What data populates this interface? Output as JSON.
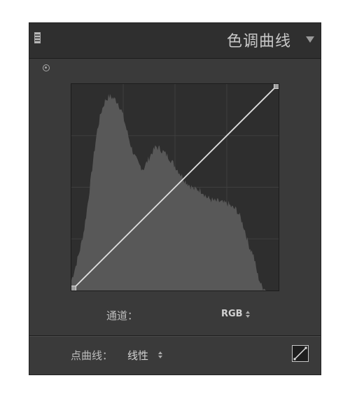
{
  "panel": {
    "title": "色调曲线",
    "grip_icon": "panel-grip-icon",
    "collapse_icon": "triangle-down-icon",
    "target_icon": "targeted-adjustment-icon"
  },
  "curve": {
    "type": "linear",
    "points": [
      [
        0,
        0
      ],
      [
        1,
        1
      ]
    ],
    "histogram": [
      0.05,
      0.12,
      0.2,
      0.3,
      0.45,
      0.62,
      0.78,
      0.88,
      0.94,
      0.96,
      0.95,
      0.93,
      0.88,
      0.8,
      0.72,
      0.66,
      0.62,
      0.6,
      0.64,
      0.68,
      0.71,
      0.7,
      0.68,
      0.66,
      0.63,
      0.6,
      0.57,
      0.54,
      0.52,
      0.5,
      0.5,
      0.49,
      0.46,
      0.45,
      0.44,
      0.44,
      0.43,
      0.43,
      0.41,
      0.4,
      0.36,
      0.3,
      0.22,
      0.18,
      0.08,
      0.02,
      0.0,
      0.0,
      0.0,
      0.0
    ]
  },
  "channel": {
    "label": "通道：",
    "value": "RGB",
    "stepper_icon": "up-down-arrows-icon"
  },
  "point_curve": {
    "label": "点曲线：",
    "value": "线性",
    "stepper_icon": "up-down-arrows-icon",
    "edit_icon": "edit-point-curve-icon"
  },
  "colors": {
    "panel_bg": "#3a3a3a",
    "header_bg": "#2f2f2f",
    "curve_bg": "#2e2e2e",
    "histogram_fill": "#585858",
    "grid": "#3f3f3f",
    "curve_line": "#e0e0e0"
  }
}
